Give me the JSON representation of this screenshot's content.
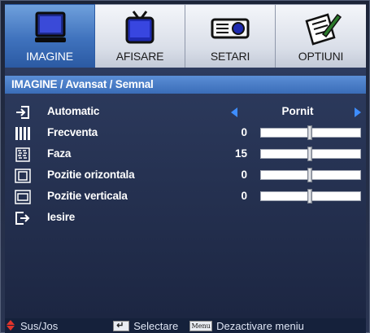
{
  "tabs": [
    {
      "label": "IMAGINE",
      "icon": "monitor-icon",
      "active": true
    },
    {
      "label": "AFISARE",
      "icon": "tv-icon",
      "active": false
    },
    {
      "label": "SETARI",
      "icon": "projector-icon",
      "active": false
    },
    {
      "label": "OPTIUNI",
      "icon": "notepad-pen-icon",
      "active": false
    }
  ],
  "breadcrumb": "IMAGINE / Avansat / Semnal",
  "rows": [
    {
      "label": "Automatic",
      "icon": "input-arrow-icon",
      "value": "Pornit",
      "type": "select"
    },
    {
      "label": "Frecventa",
      "icon": "frequency-bars-icon",
      "value": "0",
      "type": "slider",
      "level": 0.5
    },
    {
      "label": "Faza",
      "icon": "phase-pattern-icon",
      "value": "15",
      "type": "slider",
      "level": 0.5
    },
    {
      "label": "Pozitie orizontala",
      "icon": "horizontal-position-icon",
      "value": "0",
      "type": "slider",
      "level": 0.5
    },
    {
      "label": "Pozitie verticala",
      "icon": "vertical-position-icon",
      "value": "0",
      "type": "slider",
      "level": 0.5
    },
    {
      "label": "Iesire",
      "icon": "exit-icon",
      "type": "action"
    }
  ],
  "footer": {
    "nav_label": "Sus/Jos",
    "select_label": "Selectare",
    "menu_key": "Menu",
    "exit_label": "Dezactivare meniu"
  },
  "colors": {
    "accent": "#3f72bd",
    "arrow": "#3e8dff",
    "footer_arrow": "#e4352b"
  }
}
